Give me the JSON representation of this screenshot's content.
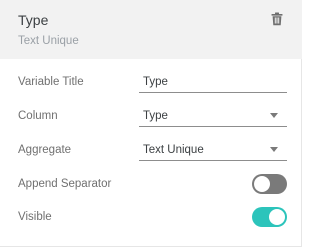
{
  "header": {
    "title": "Type",
    "subtitle": "Text Unique",
    "delete_icon": "trash-icon"
  },
  "rows": [
    {
      "label": "Variable Title",
      "kind": "text-input",
      "value": "Type"
    },
    {
      "label": "Column",
      "kind": "dropdown",
      "value": "Type"
    },
    {
      "label": "Aggregate",
      "kind": "dropdown",
      "value": "Text Unique"
    },
    {
      "label": "Append Separator",
      "kind": "toggle",
      "checked": false
    },
    {
      "label": "Visible",
      "kind": "toggle",
      "checked": true
    }
  ],
  "colors": {
    "header_bg": "#f2f2f2",
    "toggle_on": "#2cc4bb",
    "toggle_off": "#7a7a7a"
  }
}
